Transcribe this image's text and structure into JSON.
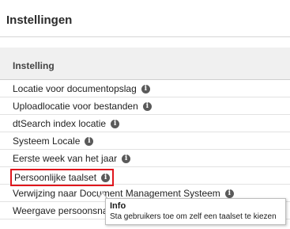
{
  "panel": {
    "title": "Instellingen"
  },
  "table": {
    "header": "Instelling",
    "rows": [
      {
        "label": "Locatie voor documentopslag"
      },
      {
        "label": "Uploadlocatie voor bestanden"
      },
      {
        "label": "dtSearch index locatie"
      },
      {
        "label": "Systeem Locale"
      },
      {
        "label": "Eerste week van het jaar"
      },
      {
        "label": "Persoonlijke taalset"
      },
      {
        "label": "Verwijzing naar Document Management Systeem"
      },
      {
        "label": "Weergave persoonsnaam"
      }
    ]
  },
  "tooltip": {
    "title": "Info",
    "body": "Sta gebruikers toe om zelf een taalset te kiezen"
  },
  "colors": {
    "highlight_border": "#e0161d",
    "header_bg": "#f0f0f0",
    "info_icon": "#5a5a5a"
  },
  "icons": {
    "info": "info-icon"
  }
}
